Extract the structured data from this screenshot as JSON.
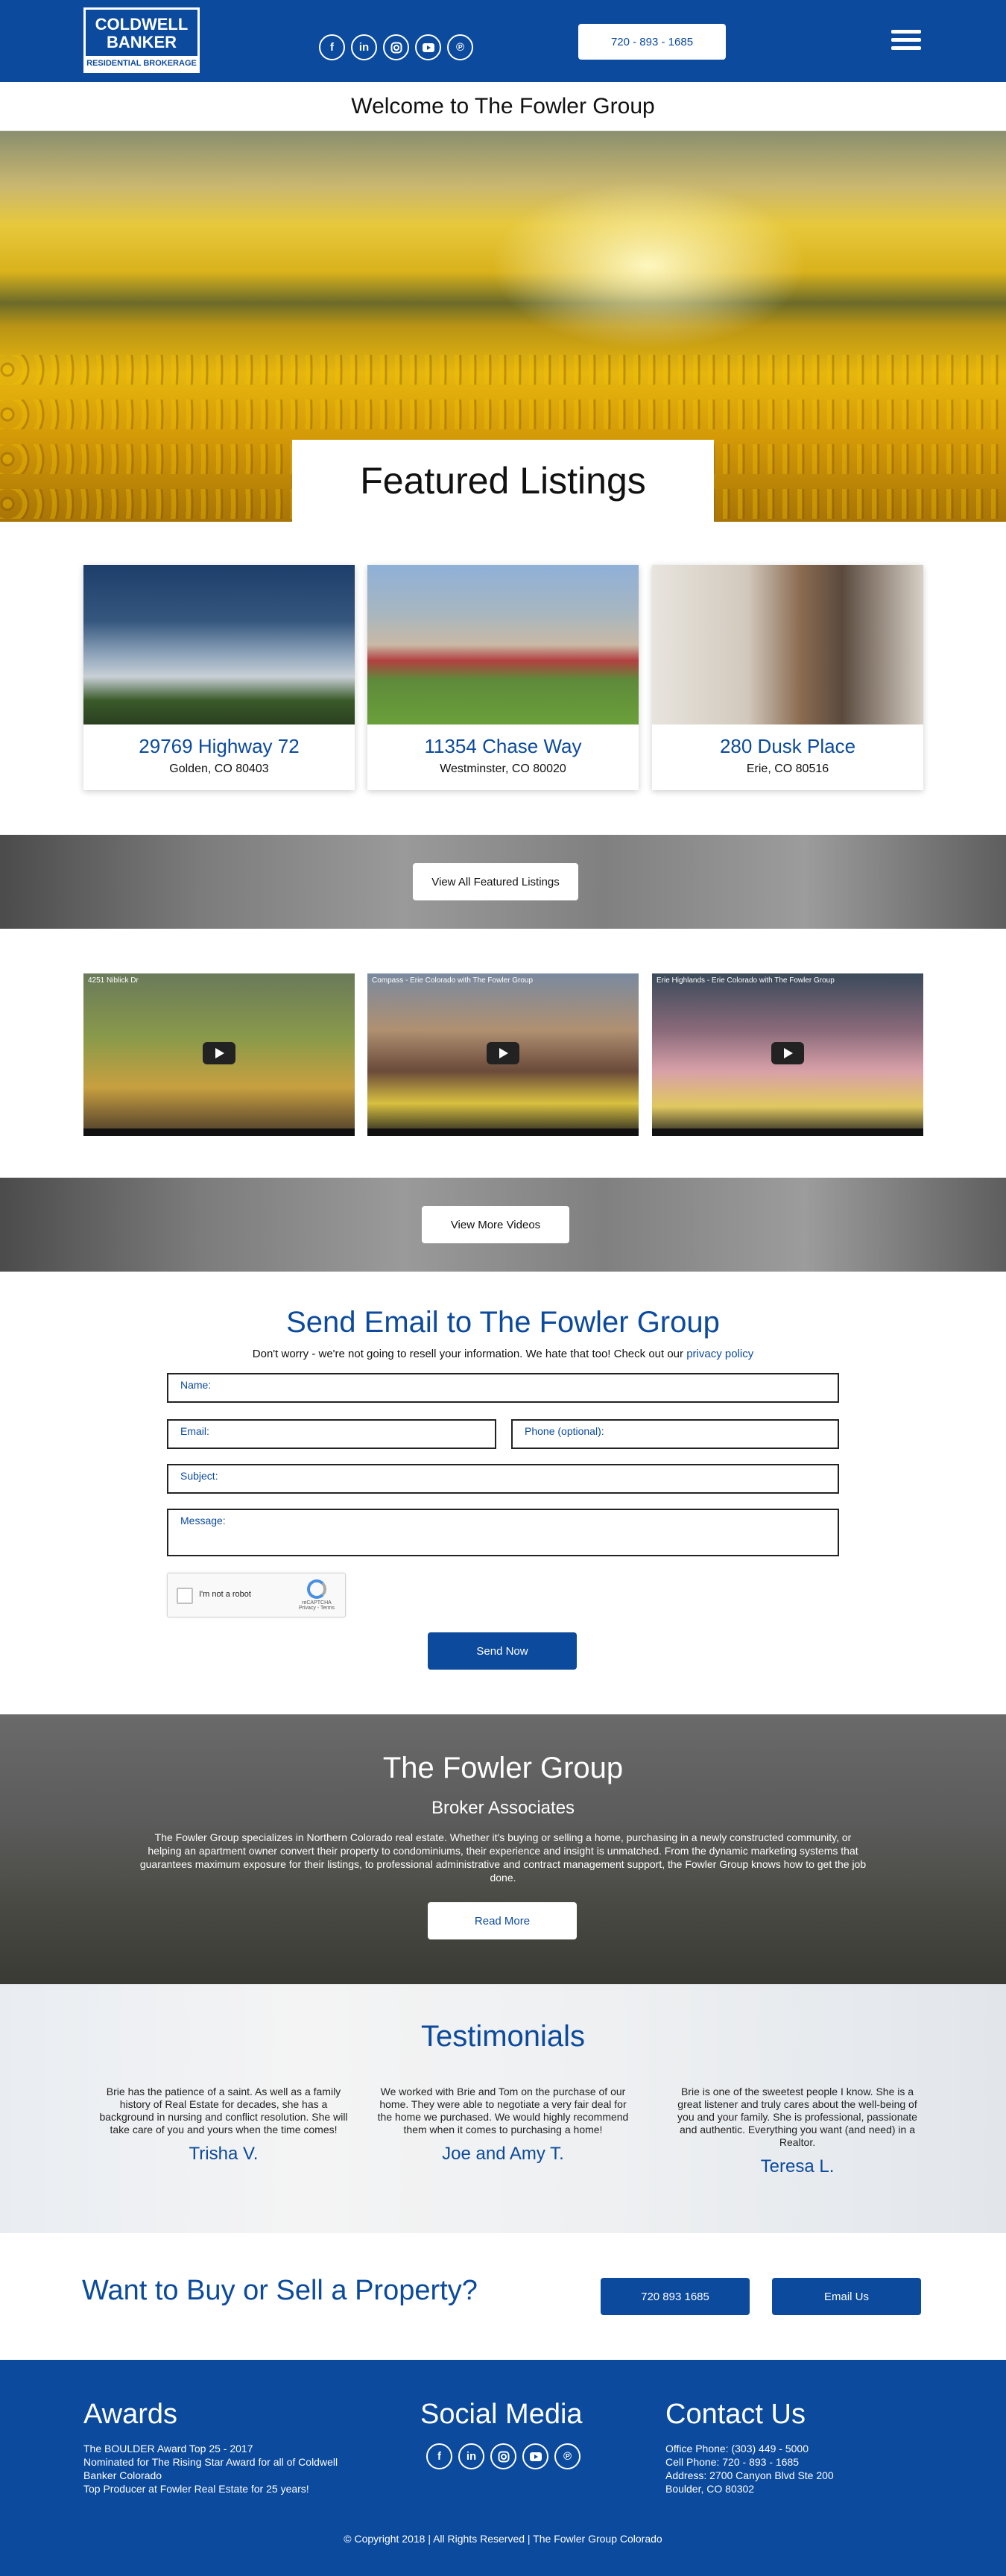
{
  "header": {
    "logo": {
      "line1": "COLDWELL",
      "line2": "BANKER",
      "line3": "RESIDENTIAL BROKERAGE"
    },
    "social": [
      "f",
      "in",
      "ig",
      "yt",
      "p"
    ],
    "phone": "720 - 893 - 1685",
    "menu_icon": "hamburger-menu-icon"
  },
  "welcome": "Welcome to The Fowler Group",
  "featured": {
    "title": "Featured Listings",
    "listings": [
      {
        "address": "29769 Highway 72",
        "city": "Golden, CO 80403"
      },
      {
        "address": "11354 Chase Way",
        "city": "Westminster, CO 80020"
      },
      {
        "address": "280 Dusk Place",
        "city": "Erie, CO 80516"
      }
    ],
    "view_all": "View All Featured Listings"
  },
  "videos": {
    "items": [
      {
        "title": "4251 Niblick Dr"
      },
      {
        "title": "Compass - Erie Colorado with The Fowler Group"
      },
      {
        "title": "Erie Highlands - Erie Colorado with The Fowler Group"
      }
    ],
    "view_more": "View More Videos"
  },
  "contact_form": {
    "title": "Send Email to The Fowler Group",
    "subtitle": "Don't worry - we're not going to resell your information. We hate that too! Check out our",
    "privacy_link": "privacy policy",
    "fields": {
      "name": "Name:",
      "email": "Email:",
      "phone": "Phone (optional):",
      "subject": "Subject:",
      "message": "Message:"
    },
    "captcha_label": "I'm not a robot",
    "captcha_brand": "reCAPTCHA",
    "captcha_terms": "Privacy - Terms",
    "send": "Send Now"
  },
  "about": {
    "title": "The Fowler Group",
    "subtitle": "Broker Associates",
    "text": "The Fowler Group specializes in Northern Colorado real estate. Whether it's buying or selling a home, purchasing in a newly constructed community, or helping an apartment owner convert their property to condominiums, their experience and insight is unmatched. From the dynamic marketing systems that guarantees maximum exposure for their listings, to professional administrative and contract management support, the Fowler Group knows how to get the job done.",
    "read_more": "Read More"
  },
  "testimonials": {
    "title": "Testimonials",
    "items": [
      {
        "quote": "Brie has the patience of a saint. As well as a family history of Real Estate for decades, she has a background in nursing and conflict resolution. She will take care of you and yours when the time comes!",
        "name": "Trisha V."
      },
      {
        "quote": "We worked with Brie and Tom on the purchase of our home. They were able to negotiate a very fair deal for the home we purchased. We would highly recommend them when it comes to purchasing a home!",
        "name": "Joe and Amy T."
      },
      {
        "quote": "Brie is one of the sweetest people I know. She is a great listener and truly cares about the well-being of you and your family. She is professional, passionate and authentic. Everything you want (and need) in a Realtor.",
        "name": "Teresa L."
      }
    ]
  },
  "cta": {
    "title": "Want to Buy or Sell a Property?",
    "phone": "720 893 1685",
    "email": "Email Us"
  },
  "footer": {
    "awards_title": "Awards",
    "awards": [
      "The BOULDER Award Top 25 - 2017",
      "Nominated for The Rising Star Award for all of Coldwell Banker Colorado",
      "Top Producer at Fowler Real Estate for 25 years!"
    ],
    "social_title": "Social Media",
    "contact_title": "Contact Us",
    "contact": [
      "Office Phone: (303) 449 - 5000",
      "Cell Phone: 720 - 893 - 1685",
      "Address:  2700 Canyon Blvd Ste 200",
      "Boulder, CO 80302"
    ],
    "copyright": "© Copyright 2018 | All Rights Reserved | The Fowler Group Colorado"
  },
  "colors": {
    "brand": "#0b4a9c",
    "white": "#ffffff"
  }
}
